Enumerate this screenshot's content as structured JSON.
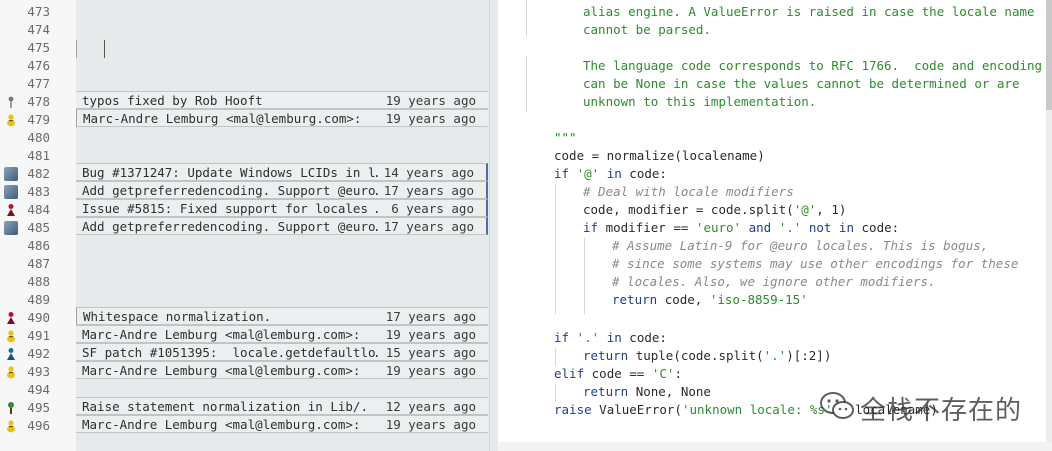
{
  "colors": {
    "string": "#2e8b2e",
    "keyword": "#1f3f8c",
    "comment": "#8a8a8a",
    "gutter_bg": "#f7f7f7",
    "blame_bg": "#e6eaea",
    "blame_mark": "#4a6fa5"
  },
  "gutter": {
    "lines": [
      {
        "n": "473",
        "avatar": ""
      },
      {
        "n": "474",
        "avatar": ""
      },
      {
        "n": "475",
        "avatar": ""
      },
      {
        "n": "476",
        "avatar": ""
      },
      {
        "n": "477",
        "avatar": ""
      },
      {
        "n": "478",
        "avatar": "pin-icon"
      },
      {
        "n": "479",
        "avatar": "duck-icon"
      },
      {
        "n": "480",
        "avatar": ""
      },
      {
        "n": "481",
        "avatar": ""
      },
      {
        "n": "482",
        "avatar": "photo-avatar"
      },
      {
        "n": "483",
        "avatar": "photo-avatar"
      },
      {
        "n": "484",
        "avatar": "figure-icon"
      },
      {
        "n": "485",
        "avatar": "photo-avatar"
      },
      {
        "n": "486",
        "avatar": ""
      },
      {
        "n": "487",
        "avatar": ""
      },
      {
        "n": "488",
        "avatar": ""
      },
      {
        "n": "489",
        "avatar": ""
      },
      {
        "n": "490",
        "avatar": "figure-icon"
      },
      {
        "n": "491",
        "avatar": "duck-icon"
      },
      {
        "n": "492",
        "avatar": "figure-blue-icon"
      },
      {
        "n": "493",
        "avatar": "duck-icon"
      },
      {
        "n": "494",
        "avatar": ""
      },
      {
        "n": "495",
        "avatar": "figure-green-icon"
      },
      {
        "n": "496",
        "avatar": "duck-icon"
      }
    ]
  },
  "blame": {
    "entries": [
      {
        "line": "478",
        "msg": "typos fixed by Rob Hooft",
        "age": "19 years ago"
      },
      {
        "line": "479",
        "msg": "Marc-Andre Lemburg <mal@lemburg.com>:",
        "age": "19 years ago"
      },
      {
        "line": "482",
        "msg": "Bug #1371247: Update Windows LCIDs in l…",
        "age": "14 years ago"
      },
      {
        "line": "483",
        "msg": "Add getpreferredencoding. Support @euro…",
        "age": "17 years ago"
      },
      {
        "line": "484",
        "msg": "Issue #5815: Fixed support for locales …",
        "age": "6 years ago"
      },
      {
        "line": "485",
        "msg": "Add getpreferredencoding. Support @euro…",
        "age": "17 years ago"
      },
      {
        "line": "490",
        "msg": "Whitespace normalization.",
        "age": "17 years ago"
      },
      {
        "line": "491",
        "msg": "Marc-Andre Lemburg <mal@lemburg.com>:",
        "age": "19 years ago"
      },
      {
        "line": "492",
        "msg": "SF patch #1051395:  locale.getdefaultlo…",
        "age": "15 years ago"
      },
      {
        "line": "493",
        "msg": "Marc-Andre Lemburg <mal@lemburg.com>:",
        "age": "19 years ago"
      },
      {
        "line": "495",
        "msg": "Raise statement normalization in Lib/.",
        "age": "12 years ago"
      },
      {
        "line": "496",
        "msg": "Marc-Andre Lemburg <mal@lemburg.com>:",
        "age": "19 years ago"
      }
    ]
  },
  "code": {
    "l473": "alias engine. A ValueError is raised in case the locale name",
    "l474": "cannot be parsed.",
    "l476": "The language code corresponds to RFC 1766.  code and encoding",
    "l477": "can be None in case the values cannot be determined or are",
    "l478": "unknown to this implementation.",
    "l480": "\"\"\"",
    "l481": "code = normalize(localename)",
    "l482_kw": "if",
    "l482_str": "'@'",
    "l482_kw2": "in",
    "l482_rest": "code:",
    "l483": "# Deal with locale modifiers",
    "l484_a": "code, modifier = code.split(",
    "l484_str": "'@'",
    "l484_b": ", 1)",
    "l485_kw": "if",
    "l485_a": "modifier ==",
    "l485_str1": "'euro'",
    "l485_kw2": "and",
    "l485_str2": "'.'",
    "l485_kw3": "not in",
    "l485_b": "code:",
    "l486": "# Assume Latin-9 for @euro locales. This is bogus,",
    "l487": "# since some systems may use other encodings for these",
    "l488": "# locales. Also, we ignore other modifiers.",
    "l489_kw": "return",
    "l489_a": "code,",
    "l489_str": "'iso-8859-15'",
    "l491_kw": "if",
    "l491_str": "'.'",
    "l491_kw2": "in",
    "l491_a": "code:",
    "l492_kw": "return",
    "l492_a": "tuple(code.split(",
    "l492_str": "'.'",
    "l492_b": ")[:2])",
    "l493_kw": "elif",
    "l493_a": "code ==",
    "l493_str": "'C'",
    "l493_b": ":",
    "l494_kw": "return",
    "l494_a": "None, None",
    "l495_kw": "raise",
    "l495_a": "ValueError(",
    "l495_str": "'unknown locale: %s'",
    "l495_b": "% localename)"
  },
  "watermark": {
    "text": "全栈不存在的",
    "logo": "wechat-logo-icon"
  }
}
